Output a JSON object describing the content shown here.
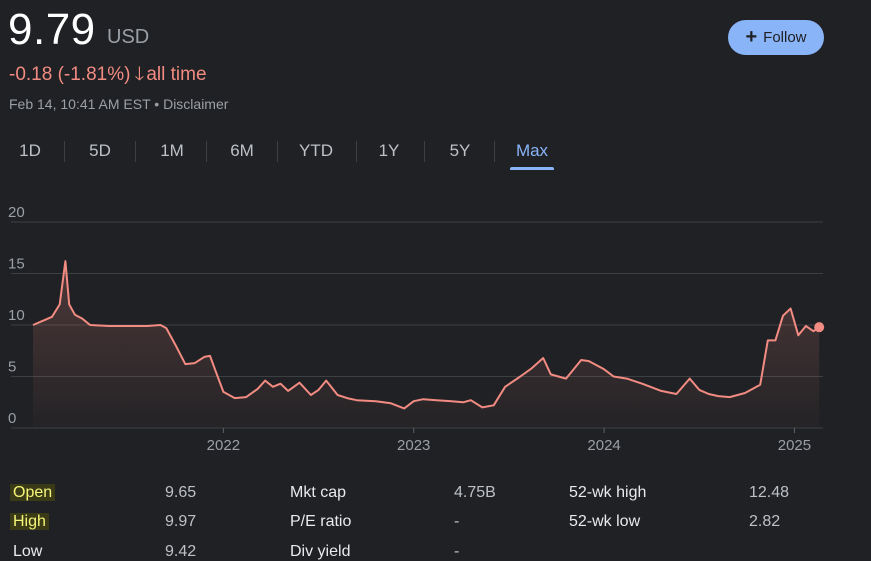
{
  "quote": {
    "price": "9.79",
    "currency": "USD",
    "change": "-0.18 (-1.81%)",
    "change_arrow": "🡓",
    "period": "all time",
    "timestamp": "Feb 14, 10:41 AM EST",
    "separator": "•",
    "disclaimer": "Disclaimer",
    "accent_down": "#f28b82"
  },
  "follow_button": {
    "icon": "plus-icon",
    "label": "Follow",
    "color": "#8ab4f8"
  },
  "tabs": [
    {
      "label": "1D"
    },
    {
      "label": "5D"
    },
    {
      "label": "1M"
    },
    {
      "label": "6M"
    },
    {
      "label": "YTD"
    },
    {
      "label": "1Y"
    },
    {
      "label": "5Y"
    },
    {
      "label": "Max",
      "active": true
    }
  ],
  "chart_data": {
    "type": "area",
    "title": "",
    "xlabel": "",
    "ylabel": "",
    "ylim": [
      0,
      20
    ],
    "y_ticks": [
      "0",
      "5",
      "10",
      "15",
      "20"
    ],
    "x_ticks": [
      "2022",
      "2023",
      "2024",
      "2025"
    ],
    "x_tick_values": [
      2022,
      2023,
      2024,
      2025
    ],
    "xlim": [
      2021.0,
      2025.15
    ],
    "grid": true,
    "line_color": "#f28b82",
    "series": [
      {
        "x": [
          2021.0,
          2021.05,
          2021.1,
          2021.14,
          2021.17,
          2021.19,
          2021.22,
          2021.26,
          2021.3,
          2021.4,
          2021.5,
          2021.6,
          2021.67,
          2021.7,
          2021.75,
          2021.8,
          2021.85,
          2021.9,
          2021.93,
          2021.96,
          2022.0,
          2022.06,
          2022.12,
          2022.18,
          2022.22,
          2022.26,
          2022.3,
          2022.34,
          2022.4,
          2022.46,
          2022.5,
          2022.54,
          2022.6,
          2022.65,
          2022.7,
          2022.8,
          2022.88,
          2022.95,
          2023.0,
          2023.05,
          2023.12,
          2023.2,
          2023.26,
          2023.3,
          2023.36,
          2023.42,
          2023.48,
          2023.56,
          2023.62,
          2023.68,
          2023.72,
          2023.8,
          2023.88,
          2023.92,
          2024.0,
          2024.05,
          2024.12,
          2024.2,
          2024.3,
          2024.38,
          2024.45,
          2024.5,
          2024.55,
          2024.6,
          2024.66,
          2024.74,
          2024.82,
          2024.86,
          2024.9,
          2024.94,
          2024.98,
          2025.02,
          2025.06,
          2025.1,
          2025.13
        ],
        "y": [
          10.0,
          10.4,
          10.8,
          12.0,
          16.2,
          12.0,
          11.0,
          10.6,
          10.0,
          9.9,
          9.9,
          9.9,
          10.0,
          9.7,
          8.0,
          6.2,
          6.3,
          6.9,
          7.0,
          5.5,
          3.5,
          2.9,
          3.0,
          3.8,
          4.6,
          4.0,
          4.3,
          3.6,
          4.4,
          3.2,
          3.7,
          4.6,
          3.2,
          2.9,
          2.7,
          2.6,
          2.4,
          1.9,
          2.6,
          2.8,
          2.7,
          2.6,
          2.5,
          2.7,
          2.0,
          2.2,
          4.0,
          5.0,
          5.8,
          6.8,
          5.2,
          4.8,
          6.6,
          6.5,
          5.7,
          5.0,
          4.8,
          4.3,
          3.6,
          3.3,
          4.8,
          3.7,
          3.3,
          3.1,
          3.0,
          3.4,
          4.2,
          8.5,
          8.5,
          10.9,
          11.6,
          9.0,
          9.9,
          9.4,
          9.79
        ]
      }
    ]
  },
  "stats": {
    "col1": [
      {
        "label": "Open",
        "value": "9.65",
        "highlighted": true
      },
      {
        "label": "High",
        "value": "9.97",
        "highlighted": true
      },
      {
        "label": "Low",
        "value": "9.42",
        "highlighted": false
      }
    ],
    "col2": [
      {
        "label": "Mkt cap",
        "value": "4.75B"
      },
      {
        "label": "P/E ratio",
        "value": "-"
      },
      {
        "label": "Div yield",
        "value": "-"
      }
    ],
    "col3": [
      {
        "label": "52-wk high",
        "value": "12.48"
      },
      {
        "label": "52-wk low",
        "value": "2.82"
      }
    ]
  }
}
